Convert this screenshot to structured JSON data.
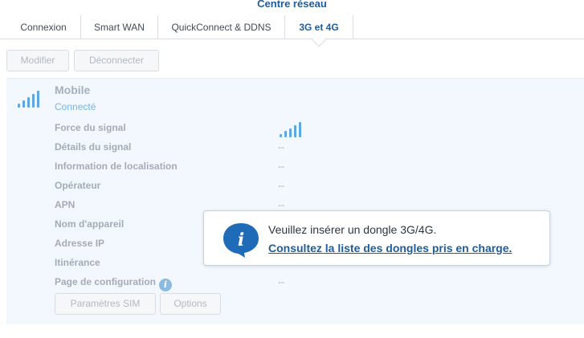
{
  "window": {
    "title": "Centre réseau"
  },
  "tabs": [
    {
      "label": "Connexion"
    },
    {
      "label": "Smart WAN"
    },
    {
      "label": "QuickConnect & DDNS"
    },
    {
      "label": "3G et 4G",
      "active": true
    }
  ],
  "toolbar": {
    "modify_label": "Modifier",
    "disconnect_label": "Déconnecter"
  },
  "connection": {
    "name": "Mobile",
    "status": "Connecté",
    "signal_bars": 5
  },
  "details": [
    {
      "label": "Force du signal",
      "value": ""
    },
    {
      "label": "Détails du signal",
      "value": "--"
    },
    {
      "label": "Information de localisation",
      "value": "--"
    },
    {
      "label": "Opérateur",
      "value": "--"
    },
    {
      "label": "APN",
      "value": "--"
    },
    {
      "label": "Nom d'appareil",
      "value": ""
    },
    {
      "label": "Adresse IP",
      "value": ""
    },
    {
      "label": "Itinérance",
      "value": ""
    },
    {
      "label": "Page de configuration",
      "value": "--"
    }
  ],
  "actions": {
    "sim_label": "Paramètres SIM",
    "options_label": "Options"
  },
  "notice": {
    "message": "Veuillez insérer un dongle 3G/4G.",
    "link": "Consultez la liste des dongles pris en charge."
  },
  "colors": {
    "accent": "#1f5c9a",
    "signal": "#5fa7e0",
    "panel_bg": "#f2f8fd"
  }
}
